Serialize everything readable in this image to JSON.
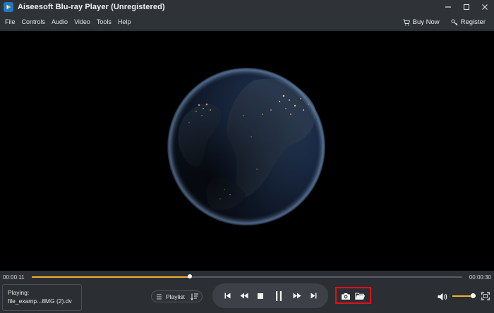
{
  "window": {
    "title": "Aiseesoft Blu-ray Player (Unregistered)",
    "icons": [
      "app-logo-icon",
      "minimize-icon",
      "maximize-icon",
      "close-icon"
    ]
  },
  "menu": {
    "items": [
      "File",
      "Controls",
      "Audio",
      "Video",
      "Tools",
      "Help"
    ],
    "buy_now": "Buy Now",
    "register": "Register"
  },
  "player": {
    "current_time": "00:00:11",
    "total_time": "00:00:30",
    "progress_fraction": 0.367,
    "volume_fraction": 0.9
  },
  "now_playing": {
    "label": "Playing:",
    "file": "file_examp...8MG (2).dv"
  },
  "playlist": {
    "label": "Playlist"
  },
  "colors": {
    "accent": "#f2b12c",
    "highlight_box": "#e0101a",
    "panel": "#2b2e33",
    "video_bg": "#000000"
  }
}
